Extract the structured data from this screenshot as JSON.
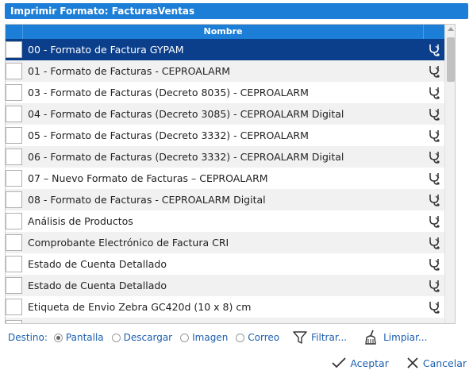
{
  "dialog": {
    "title": "Imprimir Formato: FacturasVentas"
  },
  "grid": {
    "column_header": "Nombre",
    "rows": [
      {
        "label": "00 - Formato de Factura GYPAM",
        "selected": true
      },
      {
        "label": "01 - Formato de Facturas - CEPROALARM"
      },
      {
        "label": "03 - Formato de Facturas (Decreto 8035) - CEPROALARM"
      },
      {
        "label": "04 - Formato de Facturas (Decreto 3085) - CEPROALARM Digital"
      },
      {
        "label": "05 - Formato de Facturas (Decreto 3332) - CEPROALARM"
      },
      {
        "label": "06 - Formato de Facturas (Decreto 3332) - CEPROALARM Digital"
      },
      {
        "label": "07 – Nuevo Formato de Facturas – CEPROALARM"
      },
      {
        "label": "08 - Formato de Facturas - CEPROALARM Digital"
      },
      {
        "label": "Análisis de Productos"
      },
      {
        "label": "Comprobante Electrónico de Factura CRI"
      },
      {
        "label": "Estado de Cuenta Detallado"
      },
      {
        "label": "Estado de Cuenta Detallado"
      },
      {
        "label": "Etiqueta de Envio Zebra GC420d (10 x 8) cm"
      },
      {
        "label": ""
      }
    ],
    "row_action_icon": "stethoscope-icon"
  },
  "destino": {
    "label": "Destino:",
    "options": [
      {
        "label": "Pantalla",
        "checked": true
      },
      {
        "label": "Descargar",
        "checked": false
      },
      {
        "label": "Imagen",
        "checked": false
      },
      {
        "label": "Correo",
        "checked": false
      }
    ],
    "filter_label": "Filtrar...",
    "clear_label": "Limpiar..."
  },
  "footer": {
    "accept_label": "Aceptar",
    "cancel_label": "Cancelar"
  },
  "colors": {
    "header_blue": "#1c7ed6",
    "selected_row": "#0b3f8c",
    "link_blue": "#1c5fb0"
  }
}
